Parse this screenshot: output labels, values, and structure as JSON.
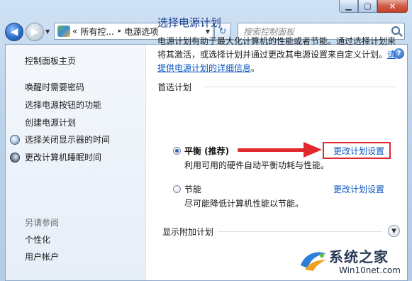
{
  "window": {
    "caption_buttons": {
      "minimize": "▁",
      "maximize": "▢",
      "close": "✕"
    }
  },
  "nav": {
    "back_icon": "left-arrow-icon",
    "forward_icon": "right-arrow-icon",
    "breadcrumb": {
      "overflow": "«",
      "root": "所有控...",
      "separator": "▸",
      "current": "电源选项"
    },
    "search": {
      "placeholder": "搜索控制面板"
    }
  },
  "sidebar": {
    "home": "控制面板主页",
    "items": [
      {
        "label": "唤醒时需要密码"
      },
      {
        "label": "选择电源按钮的功能"
      },
      {
        "label": "创建电源计划"
      },
      {
        "label": "选择关闭显示器的时间",
        "icon": "monitor-clock-icon"
      },
      {
        "label": "更改计算机睡眠时间",
        "icon": "moon-icon"
      }
    ],
    "see_also": "另请参阅",
    "see_also_items": [
      {
        "label": "个性化"
      },
      {
        "label": "用户帐户"
      }
    ]
  },
  "main": {
    "title": "选择电源计划",
    "intro_text": "电源计划有助于最大化计算机的性能或者节能。通过选择计划来将其激活，或选择计划并通过更改其电源设置来自定义计划。",
    "intro_link": "请提供电源计划的详细信息",
    "intro_end": "。",
    "preferred_section": "首选计划",
    "plans": [
      {
        "name": "平衡 (推荐)",
        "description": "利用可用的硬件自动平衡功耗与性能。",
        "link": "更改计划设置",
        "selected": true
      },
      {
        "name": "节能",
        "description": "尽可能降低计算机性能以节能。",
        "link": "更改计划设置",
        "selected": false
      }
    ],
    "more_plans": "显示附加计划"
  },
  "watermark": {
    "line1": "系统之家",
    "line2": "Win10net.com"
  },
  "colors": {
    "accent_link": "#0a56c2",
    "heading": "#1a3e8c",
    "annotation_red": "#e0282d"
  }
}
